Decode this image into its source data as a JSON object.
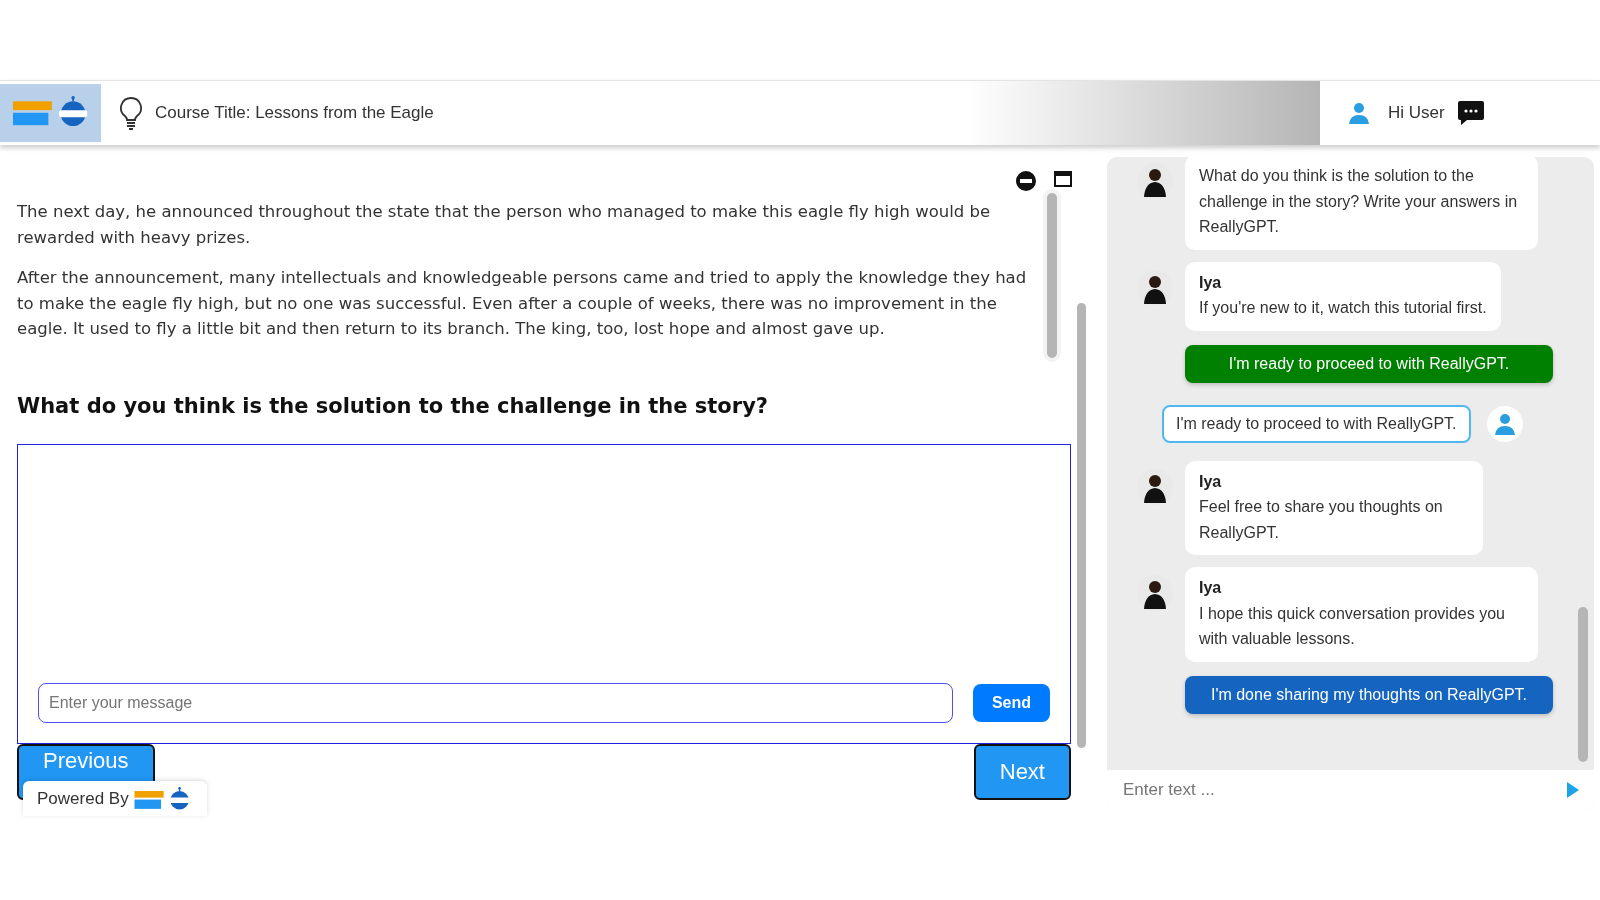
{
  "header": {
    "course_title": "Course Title: Lessons from the Eagle",
    "greeting": "Hi User"
  },
  "lesson": {
    "paragraphs": [
      "The next day, he announced throughout the state that the person who managed to make this eagle fly high would be rewarded with heavy prizes.",
      "After the announcement, many intellectuals and knowledgeable persons came and tried to apply the knowledge they had to make the eagle fly high, but no one was successful. Even after a couple of weeks, there was no improvement in the eagle. It used to fly a little bit and then return to its branch. The king, too, lost hope and almost gave up."
    ],
    "question": "What do you think is the solution to the challenge in the story?",
    "message_placeholder": "Enter your message",
    "send": "Send",
    "previous": "Previous",
    "next": "Next",
    "powered_by": "Powered By"
  },
  "chat": {
    "messages": [
      {
        "kind": "bot",
        "text": "What do you think is the solution to the challenge in the story? Write your answers in ReallyGPT."
      },
      {
        "kind": "bot",
        "name": "Iya",
        "text": "If you're new to it, watch this tutorial first."
      },
      {
        "kind": "option",
        "text": "I'm ready to proceed to with ReallyGPT.",
        "color": "#008000"
      },
      {
        "kind": "user",
        "text": "I'm ready to proceed to with ReallyGPT."
      },
      {
        "kind": "bot",
        "name": "Iya",
        "text": "Feel free to share you thoughts on ReallyGPT."
      },
      {
        "kind": "bot",
        "name": "Iya",
        "text": "I hope this quick conversation provides you with valuable lessons."
      },
      {
        "kind": "option",
        "text": "I'm done sharing my thoughts on ReallyGPT.",
        "color": "#1565c0"
      }
    ],
    "input_placeholder": "Enter text ..."
  }
}
